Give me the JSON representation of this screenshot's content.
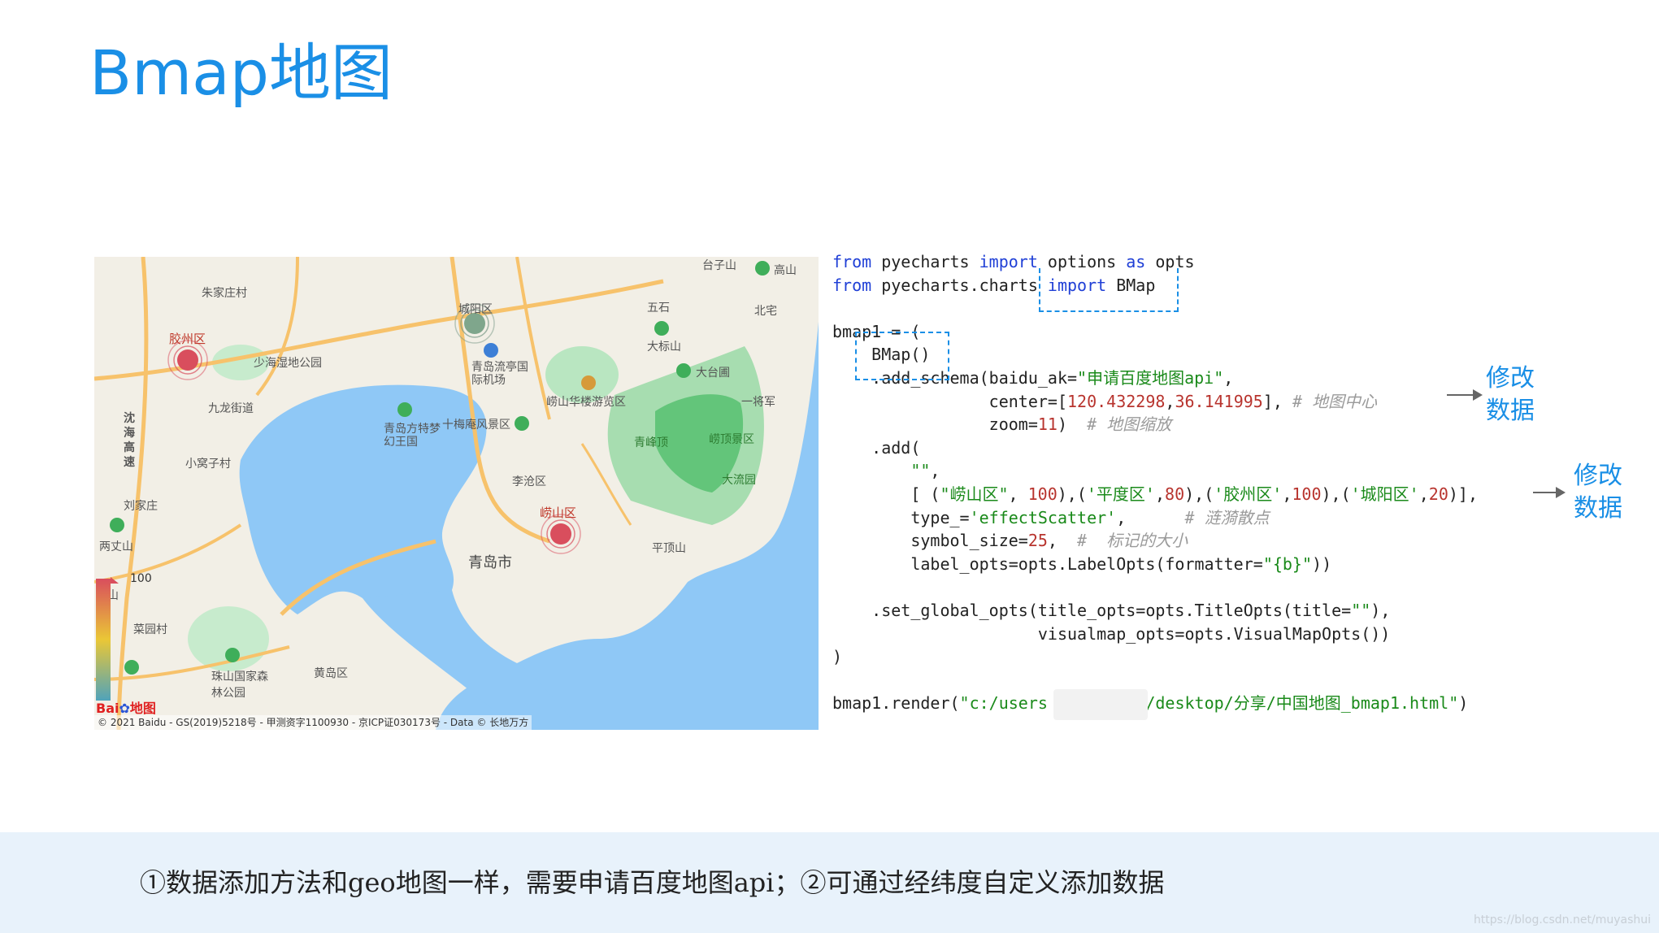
{
  "slide": {
    "title": "Bmap地图",
    "footer_text": "①数据添加方法和geo地图一样，需要申请百度地图api；②可通过经纬度自定义添加数据",
    "watermark": "https://blog.csdn.net/muyashui"
  },
  "map": {
    "place_labels": [
      "朱家庄村",
      "胶州区",
      "少海湿地公园",
      "九龙街道",
      "沈海高速",
      "小窝子村",
      "刘家庄",
      "两丈山",
      "李山",
      "菜园村",
      "珠山国家森林公园",
      "黄岛区",
      "城阳区",
      "青岛流亭国际机场",
      "崂山华楼游览区",
      "十梅庵风景区",
      "青岛方特梦幻王国",
      "李沧区",
      "崂山区",
      "青岛市",
      "平顶山",
      "大标山",
      "大台圃",
      "一将军",
      "崂顶景区",
      "青峰顶",
      "大流园",
      "台子山",
      "高山",
      "北宅",
      "五石"
    ],
    "scatter_points": [
      {
        "name": "胶州区",
        "value": 100,
        "color": "#d94e5d"
      },
      {
        "name": "城阳区",
        "value": 20,
        "color": "#50a3ba"
      },
      {
        "name": "崂山区",
        "value": 100,
        "color": "#d94e5d"
      }
    ],
    "visualmap_max": "100",
    "logo_text": "Bai",
    "logo_suffix": "地图",
    "copyright": "© 2021 Baidu - GS(2019)5218号 - 甲测资字1100930 - 京ICP证030173号 - Data © 长地万方",
    "colors": {
      "water": "#8fc8f6",
      "land": "#f2efe6",
      "park": "#a7ddb0",
      "road": "#f7c26b"
    }
  },
  "code": {
    "lines": [
      {
        "parts": [
          [
            "kw",
            "from"
          ],
          [
            "t",
            " pyecharts "
          ],
          [
            "kw",
            "import"
          ],
          [
            "t",
            " options "
          ],
          [
            "kw",
            "as"
          ],
          [
            "t",
            " opts"
          ]
        ]
      },
      {
        "parts": [
          [
            "kw",
            "from"
          ],
          [
            "t",
            " pyecharts.charts "
          ],
          [
            "kw",
            "import"
          ],
          [
            "t",
            " BMap"
          ]
        ]
      },
      {
        "parts": []
      },
      {
        "parts": [
          [
            "t",
            "bmap1 = ("
          ]
        ]
      },
      {
        "parts": [
          [
            "t",
            "    BMap()"
          ]
        ]
      },
      {
        "parts": [
          [
            "t",
            "    .add_schema(baidu_ak="
          ],
          [
            "str",
            "\"申请百度地图api\""
          ],
          [
            "t",
            ","
          ]
        ]
      },
      {
        "parts": [
          [
            "t",
            "                center=["
          ],
          [
            "num",
            "120.432298"
          ],
          [
            "t",
            ","
          ],
          [
            "num",
            "36.141995"
          ],
          [
            "t",
            "], "
          ],
          [
            "cmt",
            "# 地图中心"
          ]
        ]
      },
      {
        "parts": [
          [
            "t",
            "                zoom="
          ],
          [
            "num",
            "11"
          ],
          [
            "t",
            ")  "
          ],
          [
            "cmt",
            "# 地图缩放"
          ]
        ]
      },
      {
        "parts": [
          [
            "t",
            "    .add("
          ]
        ]
      },
      {
        "parts": [
          [
            "t",
            "        "
          ],
          [
            "str",
            "\"\""
          ],
          [
            "t",
            ","
          ]
        ]
      },
      {
        "parts": [
          [
            "t",
            "        [ ("
          ],
          [
            "str",
            "\"崂山区\""
          ],
          [
            "t",
            ", "
          ],
          [
            "num",
            "100"
          ],
          [
            "t",
            "),("
          ],
          [
            "str",
            "'平度区'"
          ],
          [
            "t",
            ","
          ],
          [
            "num",
            "80"
          ],
          [
            "t",
            "),("
          ],
          [
            "str",
            "'胶州区'"
          ],
          [
            "t",
            ","
          ],
          [
            "num",
            "100"
          ],
          [
            "t",
            "),("
          ],
          [
            "str",
            "'城阳区'"
          ],
          [
            "t",
            ","
          ],
          [
            "num",
            "20"
          ],
          [
            "t",
            ")],"
          ]
        ]
      },
      {
        "parts": [
          [
            "t",
            "        type_="
          ],
          [
            "str",
            "'effectScatter'"
          ],
          [
            "t",
            ",      "
          ],
          [
            "cmt",
            "# 涟漪散点"
          ]
        ]
      },
      {
        "parts": [
          [
            "t",
            "        symbol_size="
          ],
          [
            "num",
            "25"
          ],
          [
            "t",
            ",  "
          ],
          [
            "cmt",
            "#  标记的大小"
          ]
        ]
      },
      {
        "parts": [
          [
            "t",
            "        label_opts=opts.LabelOpts(formatter="
          ],
          [
            "str",
            "\"{b}\""
          ],
          [
            "t",
            "))"
          ]
        ]
      },
      {
        "parts": []
      },
      {
        "parts": [
          [
            "t",
            "    .set_global_opts(title_opts=opts.TitleOpts(title="
          ],
          [
            "str",
            "\"\""
          ],
          [
            "t",
            "),"
          ]
        ]
      },
      {
        "parts": [
          [
            "t",
            "                     visualmap_opts=opts.VisualMapOpts())"
          ]
        ]
      },
      {
        "parts": [
          [
            "t",
            ")"
          ]
        ]
      },
      {
        "parts": []
      },
      {
        "parts": [
          [
            "t",
            "bmap1.render("
          ],
          [
            "str",
            "\"c:/users"
          ],
          [
            "t",
            "          "
          ],
          [
            "str",
            "/desktop/分享/中国地图_bmap1.html\""
          ],
          [
            "t",
            ")"
          ]
        ]
      }
    ],
    "notes": [
      "修改\n数据",
      "修改\n数据"
    ]
  }
}
